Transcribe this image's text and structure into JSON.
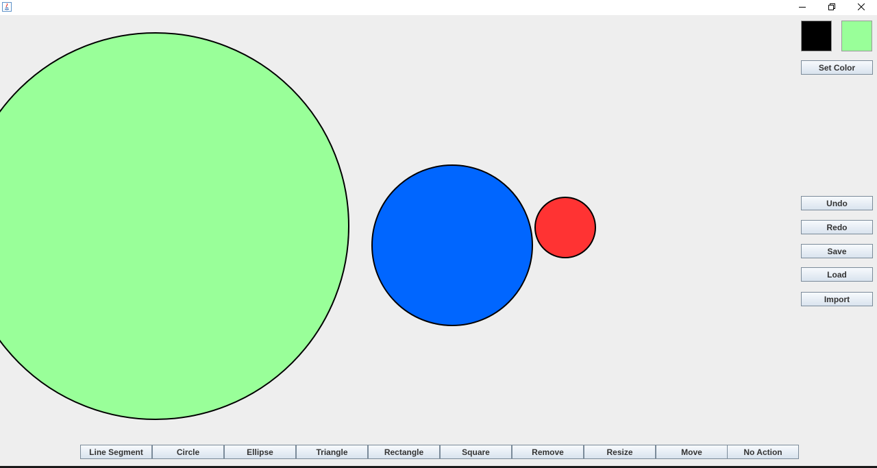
{
  "window": {
    "icons": {
      "app": "java-app-icon",
      "minimize": "minimize-icon",
      "restore": "restore-icon",
      "close": "close-icon"
    }
  },
  "colors": {
    "background": "#eeeeee",
    "stroke_color": "#000000",
    "fill_color": "#99ff99",
    "button_text": "#333333"
  },
  "side_panel": {
    "set_color_label": "Set Color",
    "actions": [
      "Undo",
      "Redo",
      "Save",
      "Load",
      "Import"
    ]
  },
  "toolbar": {
    "tools": [
      "Line Segment",
      "Circle",
      "Ellipse",
      "Triangle",
      "Rectangle",
      "Square",
      "Remove",
      "Resize",
      "Move",
      "No Action"
    ]
  },
  "shapes": [
    {
      "kind": "circle",
      "fill": "#99ff99",
      "stroke": "#000000"
    },
    {
      "kind": "circle",
      "fill": "#0066ff",
      "stroke": "#000000"
    },
    {
      "kind": "circle",
      "fill": "#ff3333",
      "stroke": "#000000"
    }
  ]
}
